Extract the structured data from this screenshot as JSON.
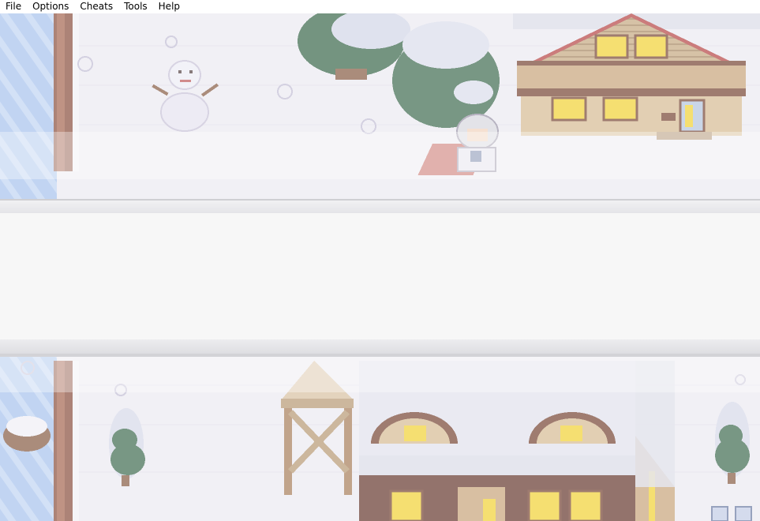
{
  "menu": {
    "items": [
      {
        "label": "File"
      },
      {
        "label": "Options"
      },
      {
        "label": "Cheats"
      },
      {
        "label": "Tools"
      },
      {
        "label": "Help"
      }
    ]
  },
  "dialog": {
    "message": ""
  },
  "scene": {
    "setting": "snowy village",
    "colors": {
      "snow": "#ecebf2",
      "shadow": "#d9d6e4",
      "wood_dark": "#7a4a3a",
      "wood_light": "#c9a77e",
      "window": "#f2d33b",
      "tree": "#3f6b4f",
      "water": "#8fb3e6",
      "roof_red": "#b84a4a"
    }
  }
}
